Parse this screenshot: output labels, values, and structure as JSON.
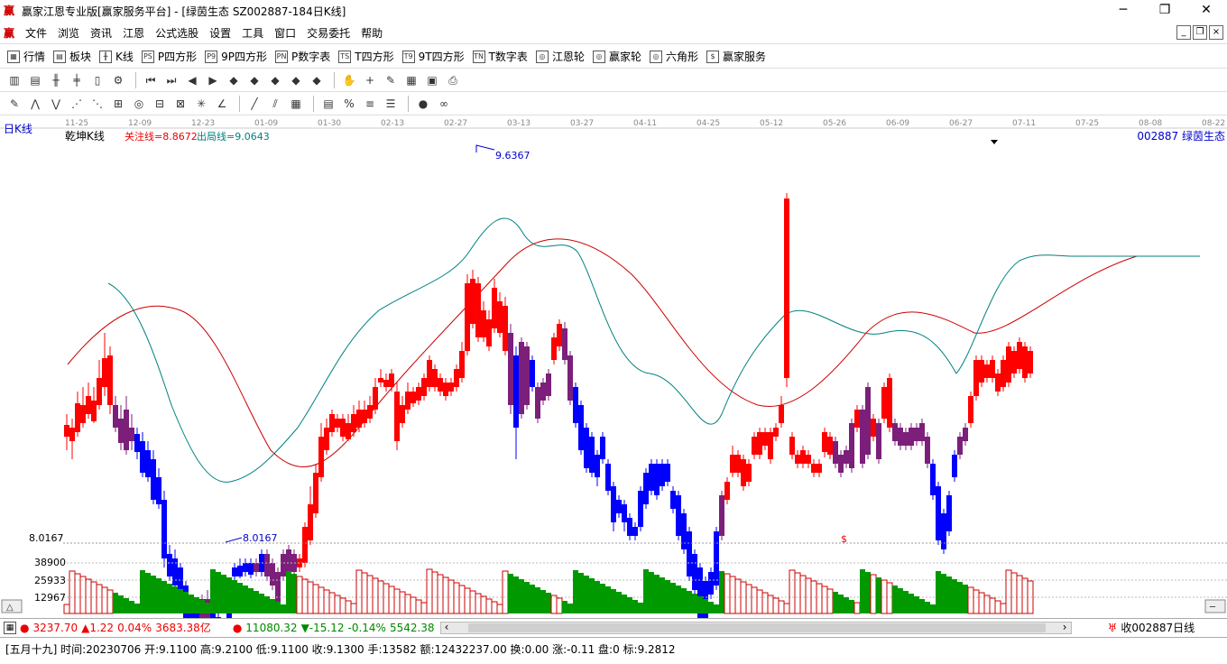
{
  "window": {
    "title": "赢家江恩专业版[赢家服务平台] - [绿茵生态  SZ002887-184日K线]",
    "btn_min": "─",
    "btn_max": "❐",
    "btn_close": "✕"
  },
  "menu": {
    "items": [
      "文件",
      "浏览",
      "资讯",
      "江恩",
      "公式选股",
      "设置",
      "工具",
      "窗口",
      "交易委托",
      "帮助"
    ]
  },
  "toolbar1": {
    "items": [
      {
        "icon": "▦",
        "label": "行情"
      },
      {
        "icon": "▤",
        "label": "板块"
      },
      {
        "icon": "╫",
        "label": "K线"
      },
      {
        "icon": "PS",
        "label": "P四方形"
      },
      {
        "icon": "P9",
        "label": "9P四方形"
      },
      {
        "icon": "PN",
        "label": "P数字表"
      },
      {
        "icon": "TS",
        "label": "T四方形"
      },
      {
        "icon": "T9",
        "label": "9T四方形"
      },
      {
        "icon": "TN",
        "label": "T数字表"
      },
      {
        "icon": "◎",
        "label": "江恩轮"
      },
      {
        "icon": "◎",
        "label": "赢家轮"
      },
      {
        "icon": "◎",
        "label": "六角形"
      },
      {
        "icon": "$",
        "label": "赢家服务"
      }
    ]
  },
  "chart_header": {
    "period_label": "日K线",
    "indicator_name": "乾坤K线",
    "focus_line": "关注线=8.8672",
    "exit_line": "出局线=9.0643",
    "stock": "002887  绿茵生态",
    "high_label": "9.6367",
    "low_label": "8.0167",
    "low_axis_label": "8.0167",
    "dollar_mark": "$"
  },
  "x_dates": [
    "11-25",
    "12-09",
    "12-23",
    "01-09",
    "01-30",
    "02-13",
    "02-27",
    "03-13",
    "03-27",
    "04-11",
    "04-25",
    "05-12",
    "05-26",
    "06-09",
    "06-27",
    "07-11",
    "07-25",
    "08-08",
    "08-22"
  ],
  "volume_axis": [
    "38900",
    "25933",
    "12967"
  ],
  "status": {
    "sh_value": "3237.70",
    "sh_change": "▲1.22",
    "sh_pct": "0.04%",
    "sh_amount": "3683.38亿",
    "sz_value": "11080.32",
    "sz_change": "▼-15.12",
    "sz_pct": "-0.14%",
    "sz_amount": "5542.38",
    "fav": "收002887日线"
  },
  "bottom": {
    "text": "[五月十九] 时间:20230706 开:9.1100 高:9.2100 低:9.1100 收:9.1300 手:13582 额:12432237.00 换:0.00 涨:-0.11 盘:0 标:9.2812"
  },
  "colors": {
    "up": "#ff0000",
    "down": "#0000ff",
    "neutral": "#7b1f7b",
    "ma_red": "#cc0000",
    "ma_teal": "#008080",
    "vol_up": "#cc0000",
    "vol_down": "#009900"
  },
  "chart_data": {
    "type": "candlestick",
    "price_range": [
      8.0167,
      9.6367
    ],
    "volume_ticks": [
      12967,
      25933,
      38900
    ]
  }
}
